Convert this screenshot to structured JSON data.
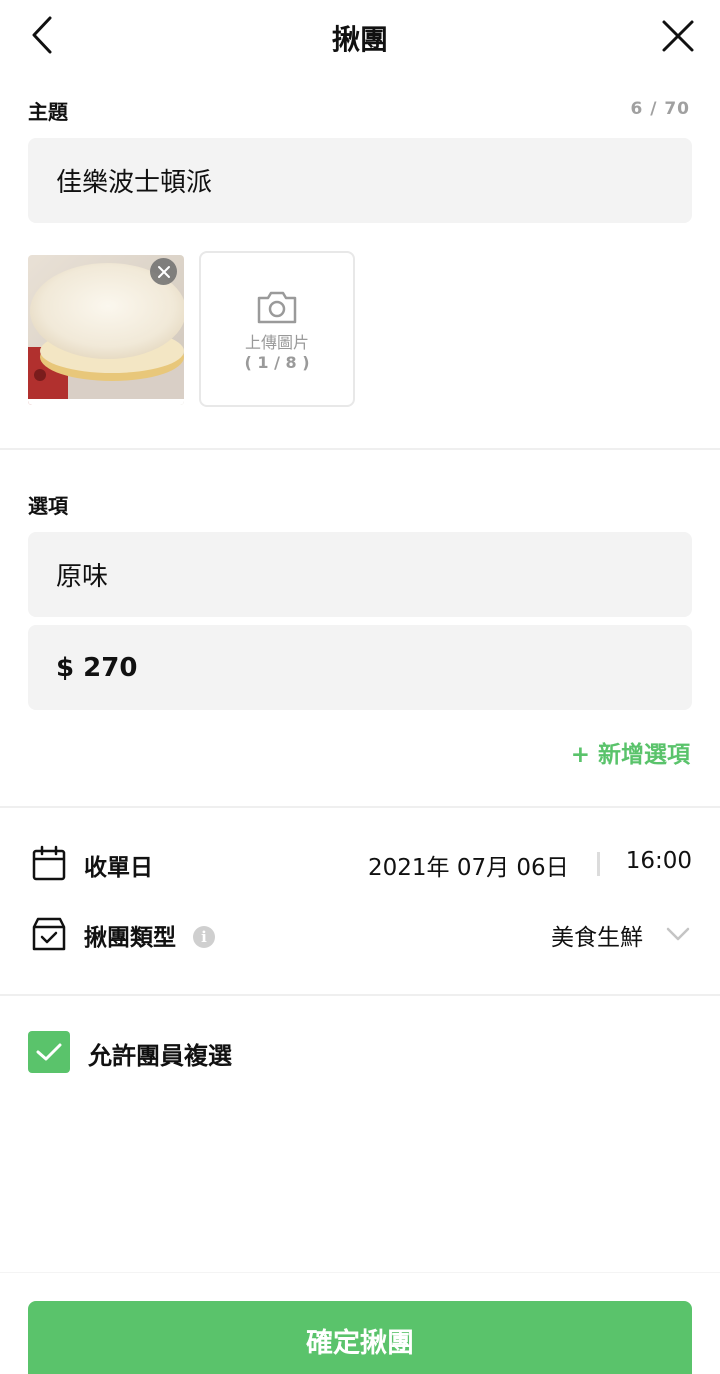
{
  "header": {
    "title": "揪團"
  },
  "subject": {
    "label": "主題",
    "counter": "6 / 70",
    "value": "佳樂波士頓派"
  },
  "images": {
    "upload_label": "上傳圖片",
    "upload_count": "( 1 / 8 )"
  },
  "options": {
    "label": "選項",
    "items": [
      {
        "name": "原味",
        "price": "$ 270"
      }
    ],
    "add_label": "+ 新增選項"
  },
  "deadline": {
    "label": "收單日",
    "date": "2021年 07月 06日",
    "time": "16:00"
  },
  "group_type": {
    "label": "揪團類型",
    "info_icon": "i",
    "value": "美食生鮮"
  },
  "multi_select": {
    "label": "允許團員複選",
    "checked": true
  },
  "confirm_button": "確定揪團",
  "colors": {
    "accent": "#5ac36b",
    "field_bg": "#f3f3f3",
    "muted": "#9a9a9a"
  }
}
